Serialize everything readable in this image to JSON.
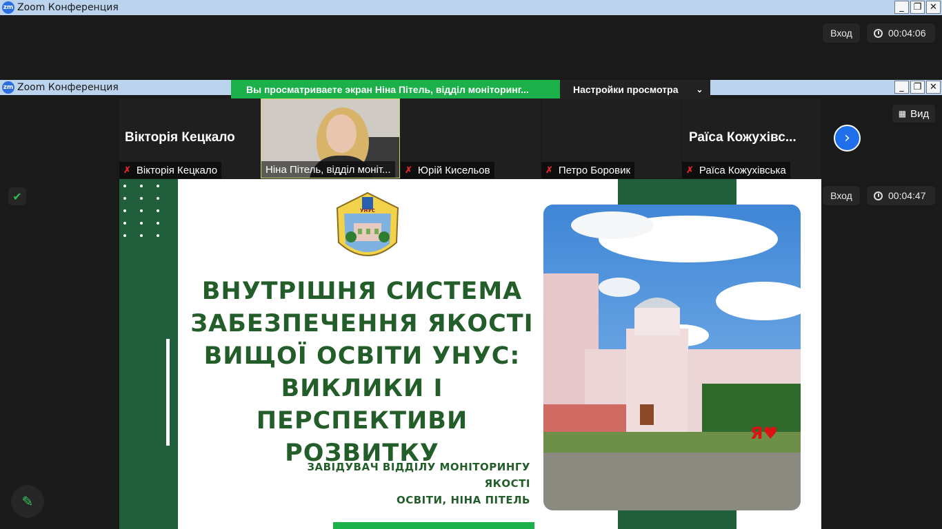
{
  "window_top": {
    "title": "Zoom Конференция",
    "logo": "zm",
    "exit_label": "Вход",
    "timer": "00:04:06"
  },
  "window_main": {
    "title": "Zoom Конференция",
    "logo": "zm",
    "share_banner": "Вы просматриваете экран Ніна Пітель, відділ моніторинг...",
    "view_settings": "Настройки просмотра",
    "exit_label": "Вход",
    "timer": "00:04:47",
    "view_button": "Вид"
  },
  "participants": [
    {
      "big_name": "Вікторія Кецкало",
      "label": "Вікторія Кецкало",
      "muted": true
    },
    {
      "big_name": "",
      "label": "Ніна Пітель, відділ моніт...",
      "muted": false,
      "video": true
    },
    {
      "big_name": "",
      "label": "Юрій Кисельов",
      "muted": true
    },
    {
      "big_name": "",
      "label": "Петро Боровик",
      "muted": true
    },
    {
      "big_name": "Раїса  Кожухівс...",
      "label": "Раїса Кожухівська",
      "muted": true
    }
  ],
  "slide": {
    "title_lines": [
      "ВНУТРІШНЯ СИСТЕМА",
      "ЗАБЕЗПЕЧЕННЯ ЯКОСТІ",
      "ВИЩОЇ ОСВІТИ УНУС:",
      "ВИКЛИКИ І ПЕРСПЕКТИВИ",
      "РОЗВИТКУ"
    ],
    "subtitle_lines": [
      "ЗАВІДУВАЧ ВІДДІЛУ МОНІТОРИНГУ ЯКОСТІ",
      "ОСВІТИ, НІНА ПІТЕЛЬ"
    ],
    "crest_text": "УНУС"
  },
  "icons": {
    "shield": "shield-check-icon",
    "pencil": "pencil-icon",
    "next": "chevron-right-icon",
    "mic_off": "mic-off-icon",
    "clock": "clock-icon"
  },
  "colors": {
    "share_green": "#1bb04a",
    "slide_green": "#215f3c",
    "title_green": "#235e2a",
    "accent_blue": "#1f6feb"
  }
}
